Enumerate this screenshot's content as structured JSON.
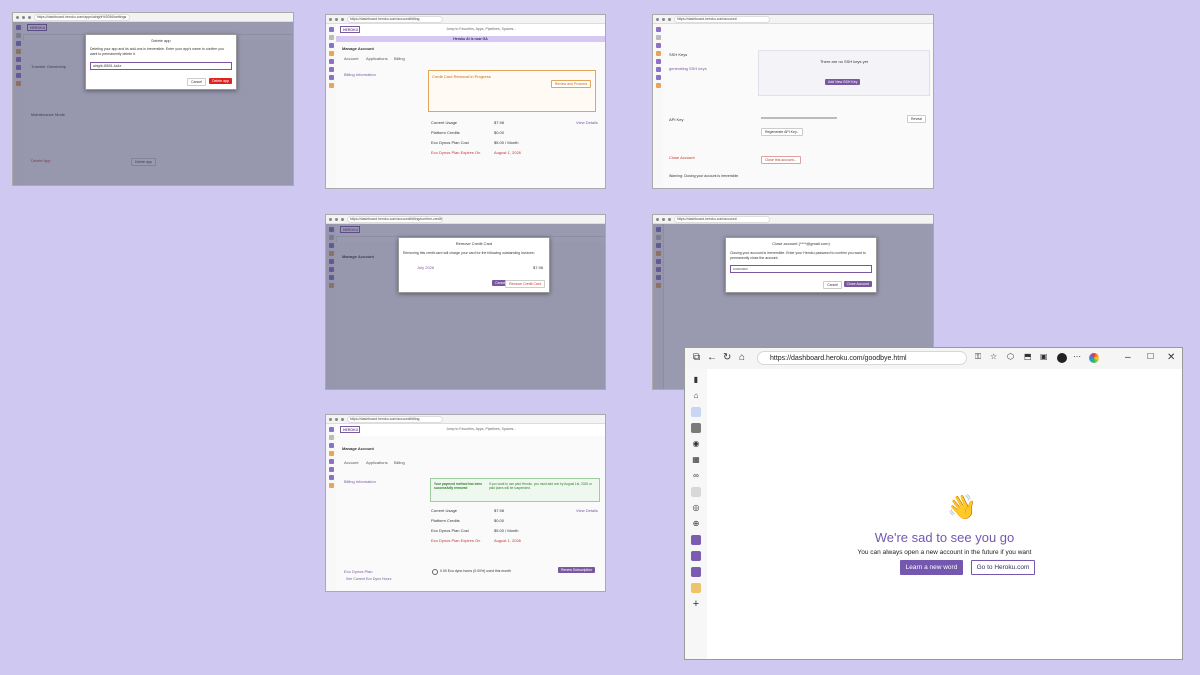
{
  "screens": {
    "delete_app": {
      "url": "https://dashboard.heroku.com/apps/alright%2056/settings",
      "modal_title": "Delete app",
      "modal_text": "Deleting your app and its add-ons is irreversible. Enter your app's name to confirm you want to permanently delete it.",
      "input_value": "alright-t3591-4a1e",
      "cancel": "Cancel",
      "delete": "Delete app",
      "bg_sections": [
        "Transfer Ownership",
        "Maintenance Mode",
        "Delete App"
      ],
      "bg_button": "Delete app"
    },
    "billing_pending": {
      "url": "https://dashboard.heroku.com/account/billing",
      "jump": "Jump to Favorites, Apps, Pipelines, Spaces...",
      "banner": "Heroku AI is now GA",
      "page_title": "Manage Account",
      "tabs": [
        "Account",
        "Applications",
        "Billing"
      ],
      "section": "Billing Information",
      "alert_title": "Credit Card Removal in Progress",
      "alert_button": "Review and Proceed",
      "usage_rows": [
        {
          "label": "Current Usage",
          "value": "$7.98",
          "link": "View Details"
        },
        {
          "label": "Platform Credits",
          "value": "$0.00"
        },
        {
          "label": "Eco Dynos Plan Cost",
          "value": "$5.00 / Month"
        },
        {
          "label": "Eco Dynos Plan Expires On",
          "value": "August 1, 2026"
        }
      ]
    },
    "account_settings": {
      "url": "https://dashboard.heroku.com/account",
      "ssh_title": "SSH Keys",
      "ssh_link": "generating SSH keys",
      "ssh_empty": "There are no SSH keys yet",
      "ssh_button": "Add New SSH Key",
      "api_title": "API Key",
      "api_reveal": "Reveal",
      "api_button": "Regenerate API Key...",
      "close_title": "Close Account",
      "close_button": "Close this account...",
      "close_warning": "Warning: Closing your account is irreversible."
    },
    "remove_card": {
      "url": "https://dashboard.heroku.com/account/billing/confirm-credit-card-removal",
      "modal_title": "Remove Credit Card",
      "modal_text": "Removing this credit card will charge your card for the following outstanding invoices:",
      "invoice": "July 2026",
      "amount": "$7.98",
      "cancel": "Cancel",
      "remove": "Remove Credit Card"
    },
    "close_account": {
      "url": "https://dashboard.heroku.com/account",
      "modal_title": "Close account (****@gmail.com)",
      "modal_text": "Closing your account is irreversible. Enter your Heroku password to confirm you want to permanently close the account.",
      "password": "••••••••••••",
      "cancel": "Cancel",
      "close": "Close Account"
    },
    "billing_done": {
      "url": "https://dashboard.heroku.com/account/billing",
      "alert_left": "Your payment method has been successfully removed",
      "alert_right": "If you want to use paid Heroku, you must add one by August 1st, 2026 or paid plans will be suspended.",
      "eco_title": "Eco Dynos Plan",
      "eco_link": "See Current Eco Dyno Hours",
      "eco_hours": "0.00 Eco dyno hours (0.00%) used this month",
      "eco_button": "Renew Subscription"
    }
  },
  "browser": {
    "url": "https://dashboard.heroku.com/goodbye.html",
    "wave_emoji": "👋",
    "headline": "We're sad to see you go",
    "subtext": "You can always open a new account in the future if you want",
    "learn_button": "Learn a new word",
    "goto_button": "Go to Heroku.com"
  }
}
